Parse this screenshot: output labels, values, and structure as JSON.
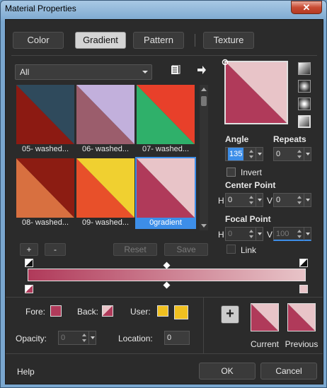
{
  "window": {
    "title": "Material Properties",
    "close_symbol": "✕"
  },
  "tabs": [
    {
      "label": "Color",
      "active": false
    },
    {
      "label": "Gradient",
      "active": true
    },
    {
      "label": "Pattern",
      "active": false
    },
    {
      "label": "Texture",
      "active": false
    }
  ],
  "library": {
    "filter_selected": "All",
    "items": [
      {
        "caption": "05- washed...",
        "c1": "#8c1a12",
        "c2": "#2f4a5c",
        "selected": false
      },
      {
        "caption": "06- washed...",
        "c1": "#9b5d6c",
        "c2": "#c2b0dc",
        "selected": false
      },
      {
        "caption": "07- washed...",
        "c1": "#2fb06a",
        "c2": "#e8402a",
        "selected": false
      },
      {
        "caption": "08- washed...",
        "c1": "#d87040",
        "c2": "#8c1c12",
        "selected": false
      },
      {
        "caption": "09- washed...",
        "c1": "#e8502a",
        "c2": "#f0d030",
        "selected": false
      },
      {
        "caption": "0gradient",
        "c1": "#b03a5a",
        "c2": "#e8c4c8",
        "selected": true
      }
    ],
    "add_label": "+",
    "remove_label": "-",
    "reset_label": "Reset",
    "save_label": "Save"
  },
  "preview": {
    "c1": "#b03a5a",
    "c2": "#e8c4c8"
  },
  "settings": {
    "angle_label": "Angle",
    "angle_value": "135",
    "repeats_label": "Repeats",
    "repeats_value": "0",
    "invert_label": "Invert",
    "invert_checked": false,
    "center_point_label": "Center Point",
    "center_h_label": "H",
    "center_h_value": "0",
    "center_v_label": "V",
    "center_v_value": "0",
    "focal_point_label": "Focal Point",
    "focal_h_label": "H",
    "focal_h_value": "0",
    "focal_v_label": "V",
    "focal_v_value": "100",
    "link_label": "Link",
    "link_checked": false
  },
  "gradient_editor": {
    "start_color": "#b03a5a",
    "end_color": "#e8c4c8"
  },
  "stops": {
    "fore_label": "Fore:",
    "back_label": "Back:",
    "user_label": "User:",
    "user_color": "#f0c020",
    "opacity_label": "Opacity:",
    "opacity_value": "0",
    "location_label": "Location:",
    "location_value": "0"
  },
  "compare": {
    "add_label": "+",
    "current_label": "Current",
    "previous_label": "Previous"
  },
  "footer": {
    "help_label": "Help",
    "ok_label": "OK",
    "cancel_label": "Cancel"
  }
}
